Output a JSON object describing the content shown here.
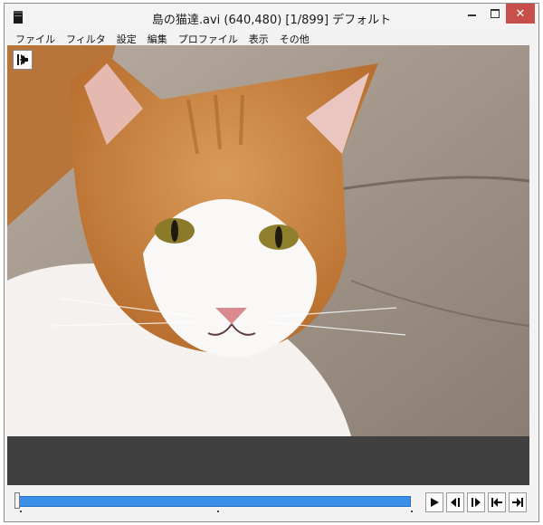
{
  "window": {
    "title": "島の猫達.avi (640,480)  [1/899]  デフォルト",
    "close_symbol": "✕"
  },
  "menu": {
    "items": [
      "ファイル",
      "フィルタ",
      "設定",
      "編集",
      "プロファイル",
      "表示",
      "その他"
    ]
  },
  "playback": {
    "current_frame": 1,
    "total_frames": 899,
    "position_fraction": 0.0
  },
  "icons": {
    "back": "jump-to-start-icon",
    "play": "play-icon",
    "prev_frame": "prev-frame-icon",
    "next_frame": "next-frame-icon",
    "first": "jump-first-icon",
    "last": "jump-last-icon"
  },
  "colors": {
    "seek_fill": "#3c8fe8",
    "close_button": "#c7504c",
    "panel": "#404040"
  }
}
